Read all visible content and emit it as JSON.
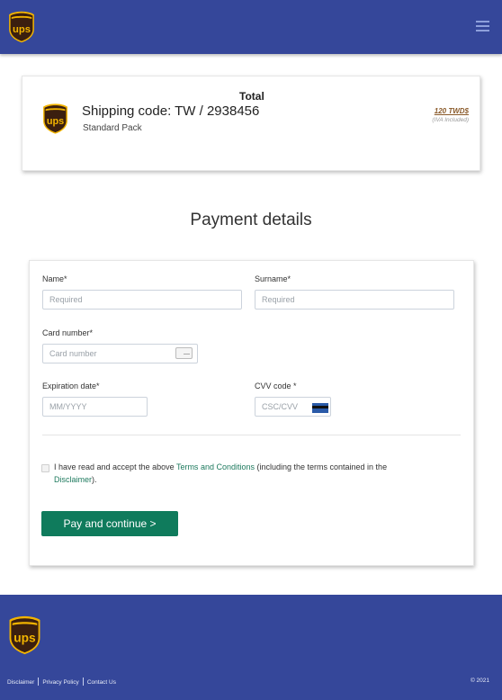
{
  "header": {
    "logo": "ups-logo",
    "logo_text": "ups",
    "menu_icon": "hamburger-menu-icon"
  },
  "summary": {
    "total_label": "Total",
    "shipping_code": "Shipping code: TW / 2938456",
    "pack_name": "Standard Pack",
    "price": "120 TWD$",
    "price_note": "(IVA Included)"
  },
  "page_title": "Payment details",
  "form": {
    "name": {
      "label": "Name*",
      "placeholder": "Required",
      "value": ""
    },
    "surname": {
      "label": "Surname*",
      "placeholder": "Required",
      "value": ""
    },
    "card_number": {
      "label": "Card number*",
      "placeholder": "Card number",
      "value": ""
    },
    "expiration": {
      "label": "Expiration date*",
      "placeholder": "MM/YYYY",
      "value": ""
    },
    "cvv": {
      "label": "CVV code *",
      "placeholder": "CSC/CVV",
      "value": ""
    },
    "consent": {
      "text_before": "I have read and accept the above ",
      "terms_link": "Terms and Conditions",
      "text_middle": " (including the terms contained in the ",
      "disclaimer_link": "Disclaimer",
      "text_after": ").",
      "checked": false
    },
    "submit_label": "Pay and continue >"
  },
  "footer": {
    "links": [
      "Disclaimer",
      "Privacy Policy",
      "Contact Us"
    ],
    "copyright": "© 2021"
  },
  "colors": {
    "brand_blue": "#35479a",
    "action_green": "#0f7b5c",
    "ups_brown": "#3b1f0f",
    "ups_gold": "#f2b400"
  }
}
